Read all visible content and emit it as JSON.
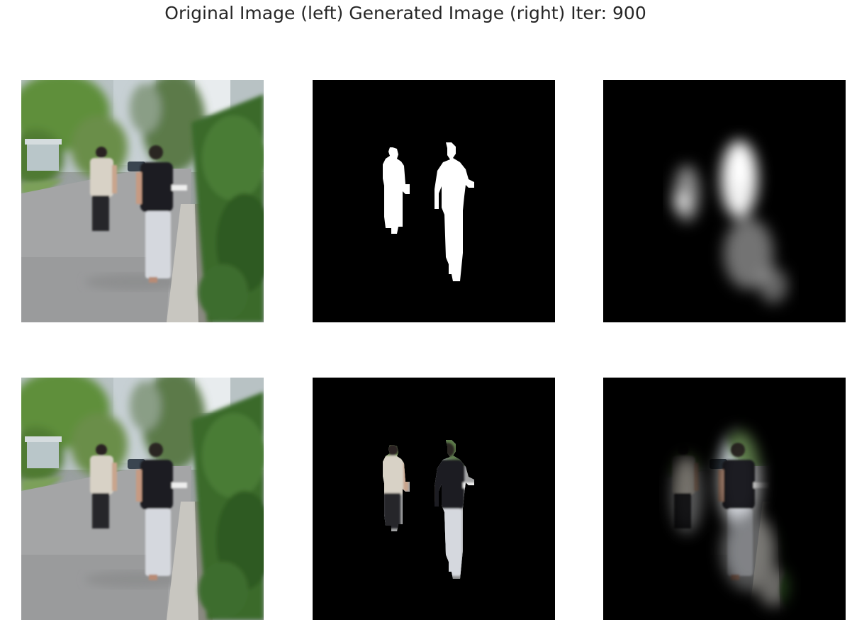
{
  "figure": {
    "title": "Original Image (left) Generated Image (right) Iter: 900"
  },
  "rows": [
    {
      "panels": [
        "original-photo",
        "ground-truth-mask",
        "predicted-mask"
      ]
    },
    {
      "panels": [
        "original-photo",
        "masked-photo",
        "generated-masked-photo"
      ]
    }
  ],
  "colors": {
    "background": "#ffffff",
    "title_text": "#262626",
    "mask_foreground": "#ffffff",
    "mask_background": "#000000"
  }
}
